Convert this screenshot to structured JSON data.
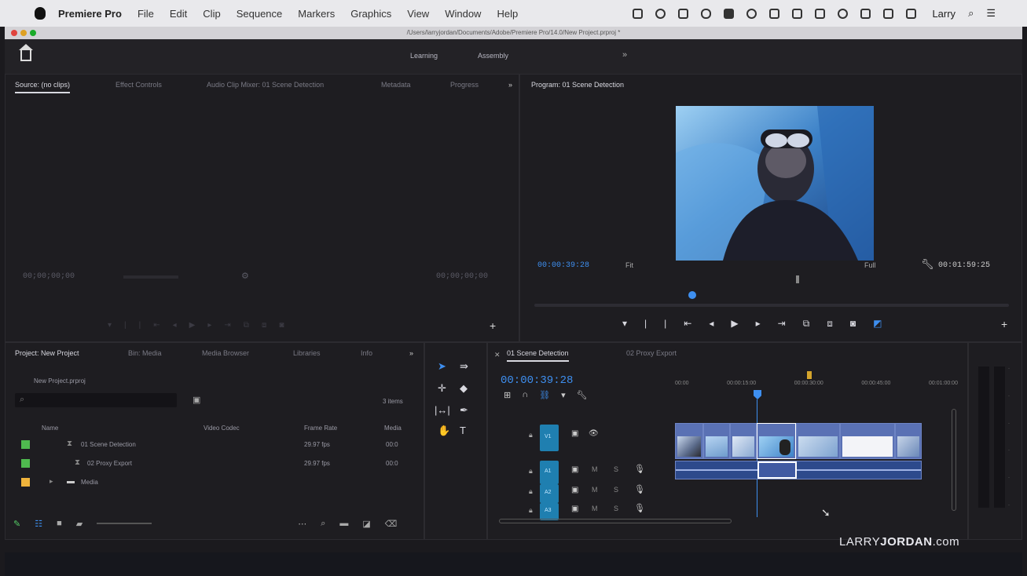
{
  "menubar": {
    "app_name": "Premiere Pro",
    "items": [
      "File",
      "Edit",
      "Clip",
      "Sequence",
      "Markers",
      "Graphics",
      "View",
      "Window",
      "Help"
    ],
    "user": "Larry"
  },
  "window": {
    "path": "/Users/larryjordan/Documents/Adobe/Premiere Pro/14.0/New Project.prproj *"
  },
  "header": {
    "workspaces": [
      "Learning",
      "Assembly"
    ],
    "more_label": "»"
  },
  "source_panel": {
    "tabs": [
      "Source: (no clips)",
      "Effect Controls",
      "Audio Clip Mixer: 01 Scene Detection",
      "Metadata",
      "Progress"
    ],
    "overflow": "»",
    "timecode_in": "00;00;00;00",
    "timecode_out": "00;00;00;00"
  },
  "program_panel": {
    "tab": "Program: 01 Scene Detection",
    "timecode": "00:00:39:28",
    "fit": "Fit",
    "quality": "Full",
    "duration": "00:01:59:25",
    "overlay_colors": {
      "ice_light": "#8fc3ec",
      "ice_mid": "#3d82c8",
      "ice_dark": "#1a3f7e"
    }
  },
  "project_panel": {
    "tabs": [
      "Project: New Project",
      "Bin: Media",
      "Media Browser",
      "Libraries",
      "Info"
    ],
    "overflow": "»",
    "project_file": "New Project.prproj",
    "item_count": "3 items",
    "columns": [
      "Name",
      "Video Codec",
      "Frame Rate",
      "Media"
    ],
    "rows": [
      {
        "name": "01 Scene Detection",
        "rate": "29.97 fps",
        "media": "00:0",
        "color": "#4fba4f",
        "type": "sequence"
      },
      {
        "name": "02 Proxy Export",
        "rate": "29.97 fps",
        "media": "00:0",
        "color": "#4fba4f",
        "type": "sequence"
      },
      {
        "name": "Media",
        "rate": "",
        "media": "",
        "color": "#f0b43c",
        "type": "bin"
      }
    ]
  },
  "timeline": {
    "tabs": [
      "01 Scene Detection",
      "02 Proxy Export"
    ],
    "timecode": "00:00:39:28",
    "ruler": [
      "00:00",
      "00:00:15:00",
      "00:00:30:00",
      "00:00:45:00",
      "00:01:00:00"
    ],
    "tracks": [
      "V1",
      "A1",
      "A2",
      "A3"
    ]
  },
  "watermark": {
    "prefix": "LARRY",
    "bold": "JORDAN",
    "suffix": ".com"
  }
}
